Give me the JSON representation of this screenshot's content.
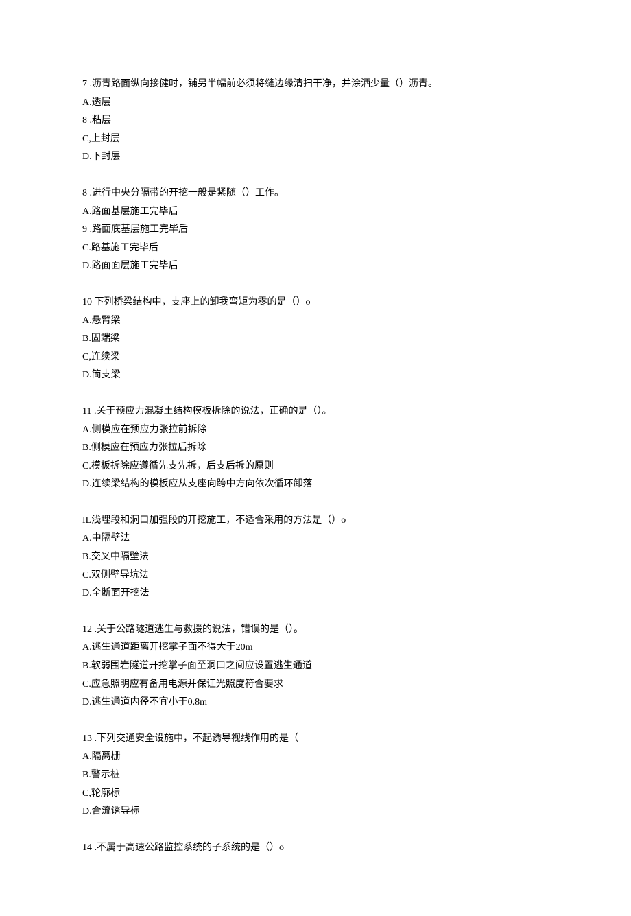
{
  "questions": [
    {
      "stem": "7 .沥青路面纵向接健时，铺另半幅前必须将缝边缘清扫干净，并涂洒少量（）沥青。",
      "options": [
        "A.透层",
        "8 .粘层",
        "C,上封层",
        "D.下封层"
      ]
    },
    {
      "stem": "8 .进行中央分隔带的开挖一般是紧随（）工作。",
      "options": [
        "A.路面基层施工完毕后",
        "9 .路面底基层施工完毕后",
        "C.路基施工完毕后",
        "D.路面面层施工完毕后"
      ]
    },
    {
      "stem": "10 下列桥梁结构中，支座上的卸我弯矩为零的是（）o",
      "options": [
        "A.悬臂梁",
        "B.固端梁",
        "C,连续梁",
        "D.简支梁"
      ]
    },
    {
      "stem": "11 .关于预应力混凝土结构模板拆除的说法，正确的是（）。",
      "options": [
        "A.侧模应在预应力张拉前拆除",
        "B.侧模应在预应力张拉后拆除",
        "C.模板拆除应遵循先支先拆，后支后拆的原则",
        "D.连续梁结构的模板应从支座向跨中方向依次循环卸落"
      ]
    },
    {
      "stem": "IL浅埋段和洞口加强段的开挖施工，不适合采用的方法是（）o",
      "options": [
        "A.中隔壁法",
        "B.交叉中隔壁法",
        "C.双侧壁导坑法",
        "D.全断面开挖法"
      ]
    },
    {
      "stem": "12 .关于公路隧道逃生与救援的说法，错误的是（）。",
      "options": [
        "A.逃生通道距离开挖掌子面不得大于20m",
        "B.软弱围岩隧道开挖掌子面至洞口之间应设置逃生通道",
        "C.应急照明应有备用电源并保证光照度符合要求",
        "D.逃生通道内径不宜小于0.8m"
      ]
    },
    {
      "stem": "13 .下列交通安全设施中，不起诱导视线作用的是（",
      "options": [
        "A.隔离栅",
        "B.警示桩",
        "C,轮廓标",
        "D.合流诱导标"
      ]
    },
    {
      "stem": "14 .不属于高速公路监控系统的子系统的是（）o",
      "options": []
    }
  ]
}
